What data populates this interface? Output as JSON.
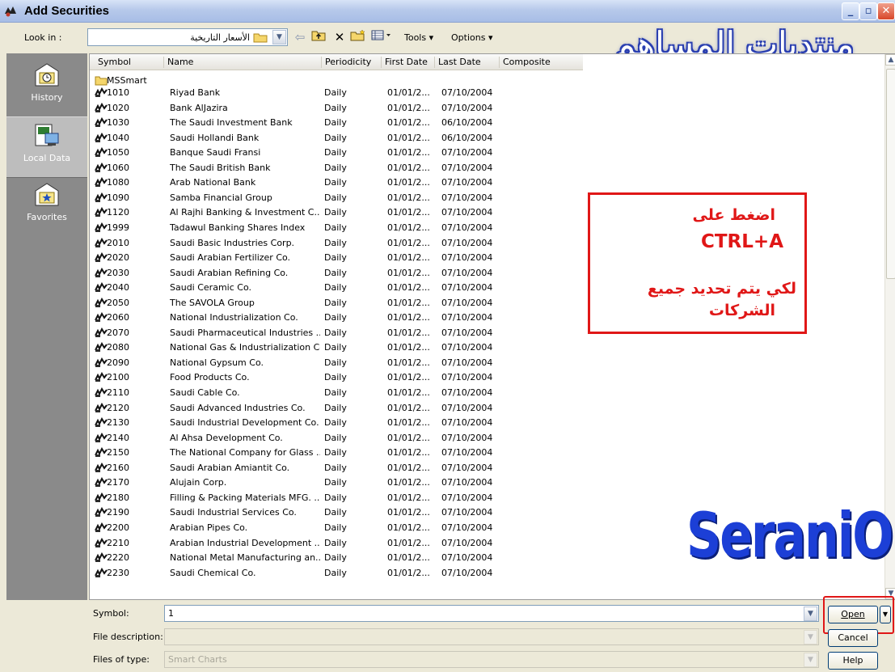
{
  "window": {
    "title": "Add Securities",
    "min_label": "_",
    "max_label": "▫",
    "close_label": "✕"
  },
  "lookin": {
    "label": "Look in :",
    "value": "الأسعار التاريخية"
  },
  "toolbar": {
    "tools_label": "Tools ▾",
    "options_label": "Options ▾",
    "watermark": "منتديات المساهم"
  },
  "places": [
    {
      "label": "History",
      "icon": "history-icon"
    },
    {
      "label": "Local Data",
      "icon": "local-data-icon"
    },
    {
      "label": "Favorites",
      "icon": "favorites-icon"
    }
  ],
  "columns": [
    "Symbol",
    "Name",
    "Periodicity",
    "First Date",
    "Last Date",
    "Composite"
  ],
  "folder_row": "MSSmart",
  "rows": [
    {
      "symbol": "1010",
      "name": "Riyad Bank",
      "periodicity": "Daily",
      "first": "01/01/2...",
      "last": "07/10/2004"
    },
    {
      "symbol": "1020",
      "name": "Bank AlJazira",
      "periodicity": "Daily",
      "first": "01/01/2...",
      "last": "07/10/2004"
    },
    {
      "symbol": "1030",
      "name": "The Saudi Investment Bank",
      "periodicity": "Daily",
      "first": "01/01/2...",
      "last": "06/10/2004"
    },
    {
      "symbol": "1040",
      "name": "Saudi Hollandi Bank",
      "periodicity": "Daily",
      "first": "01/01/2...",
      "last": "06/10/2004"
    },
    {
      "symbol": "1050",
      "name": "Banque Saudi Fransi",
      "periodicity": "Daily",
      "first": "01/01/2...",
      "last": "07/10/2004"
    },
    {
      "symbol": "1060",
      "name": "The Saudi British Bank",
      "periodicity": "Daily",
      "first": "01/01/2...",
      "last": "07/10/2004"
    },
    {
      "symbol": "1080",
      "name": "Arab National Bank",
      "periodicity": "Daily",
      "first": "01/01/2...",
      "last": "07/10/2004"
    },
    {
      "symbol": "1090",
      "name": "Samba Financial Group",
      "periodicity": "Daily",
      "first": "01/01/2...",
      "last": "07/10/2004"
    },
    {
      "symbol": "1120",
      "name": "Al Rajhi Banking & Investment C...",
      "periodicity": "Daily",
      "first": "01/01/2...",
      "last": "07/10/2004"
    },
    {
      "symbol": "1999",
      "name": "Tadawul Banking Shares Index",
      "periodicity": "Daily",
      "first": "01/01/2...",
      "last": "07/10/2004"
    },
    {
      "symbol": "2010",
      "name": "Saudi Basic Industries Corp.",
      "periodicity": "Daily",
      "first": "01/01/2...",
      "last": "07/10/2004"
    },
    {
      "symbol": "2020",
      "name": "Saudi Arabian Fertilizer Co.",
      "periodicity": "Daily",
      "first": "01/01/2...",
      "last": "07/10/2004"
    },
    {
      "symbol": "2030",
      "name": "Saudi Arabian Refining Co.",
      "periodicity": "Daily",
      "first": "01/01/2...",
      "last": "07/10/2004"
    },
    {
      "symbol": "2040",
      "name": "Saudi Ceramic Co.",
      "periodicity": "Daily",
      "first": "01/01/2...",
      "last": "07/10/2004"
    },
    {
      "symbol": "2050",
      "name": "The SAVOLA Group",
      "periodicity": "Daily",
      "first": "01/01/2...",
      "last": "07/10/2004"
    },
    {
      "symbol": "2060",
      "name": "National Industrialization Co.",
      "periodicity": "Daily",
      "first": "01/01/2...",
      "last": "07/10/2004"
    },
    {
      "symbol": "2070",
      "name": "Saudi Pharmaceutical Industries ...",
      "periodicity": "Daily",
      "first": "01/01/2...",
      "last": "07/10/2004"
    },
    {
      "symbol": "2080",
      "name": "National Gas & Industrialization Co.",
      "periodicity": "Daily",
      "first": "01/01/2...",
      "last": "07/10/2004"
    },
    {
      "symbol": "2090",
      "name": "National Gypsum Co.",
      "periodicity": "Daily",
      "first": "01/01/2...",
      "last": "07/10/2004"
    },
    {
      "symbol": "2100",
      "name": "Food Products Co.",
      "periodicity": "Daily",
      "first": "01/01/2...",
      "last": "07/10/2004"
    },
    {
      "symbol": "2110",
      "name": "Saudi Cable Co.",
      "periodicity": "Daily",
      "first": "01/01/2...",
      "last": "07/10/2004"
    },
    {
      "symbol": "2120",
      "name": "Saudi Advanced Industries Co.",
      "periodicity": "Daily",
      "first": "01/01/2...",
      "last": "07/10/2004"
    },
    {
      "symbol": "2130",
      "name": "Saudi Industrial Development Co.",
      "periodicity": "Daily",
      "first": "01/01/2...",
      "last": "07/10/2004"
    },
    {
      "symbol": "2140",
      "name": "Al Ahsa Development Co.",
      "periodicity": "Daily",
      "first": "01/01/2...",
      "last": "07/10/2004"
    },
    {
      "symbol": "2150",
      "name": "The National Company for Glass ...",
      "periodicity": "Daily",
      "first": "01/01/2...",
      "last": "07/10/2004"
    },
    {
      "symbol": "2160",
      "name": "Saudi Arabian Amiantit Co.",
      "periodicity": "Daily",
      "first": "01/01/2...",
      "last": "07/10/2004"
    },
    {
      "symbol": "2170",
      "name": "Alujain Corp.",
      "periodicity": "Daily",
      "first": "01/01/2...",
      "last": "07/10/2004"
    },
    {
      "symbol": "2180",
      "name": "Filling & Packing Materials MFG. ...",
      "periodicity": "Daily",
      "first": "01/01/2...",
      "last": "07/10/2004"
    },
    {
      "symbol": "2190",
      "name": "Saudi Industrial Services Co.",
      "periodicity": "Daily",
      "first": "01/01/2...",
      "last": "07/10/2004"
    },
    {
      "symbol": "2200",
      "name": "Arabian Pipes Co.",
      "periodicity": "Daily",
      "first": "01/01/2...",
      "last": "07/10/2004"
    },
    {
      "symbol": "2210",
      "name": "Arabian Industrial Development ...",
      "periodicity": "Daily",
      "first": "01/01/2...",
      "last": "07/10/2004"
    },
    {
      "symbol": "2220",
      "name": "National Metal Manufacturing an...",
      "periodicity": "Daily",
      "first": "01/01/2...",
      "last": "07/10/2004"
    },
    {
      "symbol": "2230",
      "name": "Saudi Chemical Co.",
      "periodicity": "Daily",
      "first": "01/01/2...",
      "last": "07/10/2004"
    }
  ],
  "note": {
    "line1": "اضغط على",
    "line2": "CTRL+A",
    "line3": "لكي يتم تحديد جميع",
    "line4": "الشركات"
  },
  "brand": "SeraniO",
  "form": {
    "symbol_label": "Symbol:",
    "symbol_value": "1",
    "description_label": "File description:",
    "description_value": "",
    "type_label": "Files of type:",
    "type_value": "Smart Charts"
  },
  "buttons": {
    "open": "Open",
    "cancel": "Cancel",
    "help": "Help"
  },
  "colors": {
    "annotation_red": "#e01717",
    "brand_blue": "#1c3fd6",
    "places_bg": "#8a8a8a"
  }
}
